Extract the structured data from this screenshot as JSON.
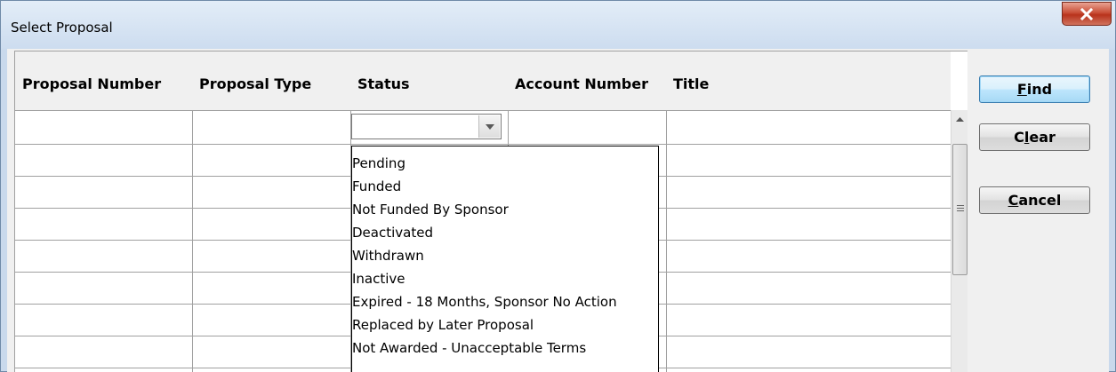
{
  "window": {
    "title": "Select Proposal",
    "close_icon": "close-x-icon"
  },
  "grid": {
    "columns": [
      "Proposal Number",
      "Proposal Type",
      "Status",
      "Account Number",
      "Title"
    ],
    "status_filter_value": ""
  },
  "status_dropdown": {
    "options": [
      "Pending",
      "Funded",
      "Not Funded By Sponsor",
      "Deactivated",
      "Withdrawn",
      "Inactive",
      "Expired - 18 Months, Sponsor No Action",
      "Replaced by Later Proposal",
      "Not Awarded - Unacceptable Terms"
    ]
  },
  "buttons": {
    "find": {
      "label": "Find",
      "mnemonic": "F"
    },
    "clear": {
      "label": "Clear",
      "mnemonic": "l"
    },
    "cancel": {
      "label": "Cancel",
      "mnemonic": "C"
    }
  },
  "colors": {
    "title_bar": "#ccdcef",
    "close_button": "#c94f38",
    "default_button": "#bee6fd"
  }
}
